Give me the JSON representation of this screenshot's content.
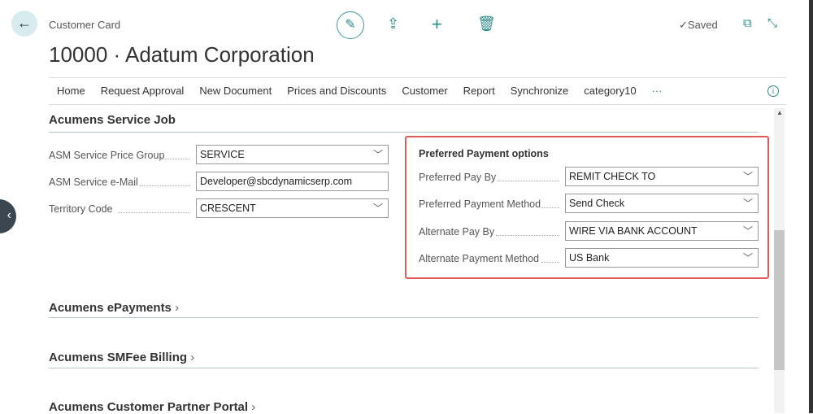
{
  "header": {
    "breadcrumb": "Customer Card",
    "title": "10000 · Adatum Corporation",
    "saved": "✓Saved"
  },
  "nav": [
    "Home",
    "Request Approval",
    "New Document",
    "Prices and Discounts",
    "Customer",
    "Report",
    "Synchronize",
    "category10",
    "···"
  ],
  "service_job": {
    "title": "Acumens Service Job",
    "fields": [
      {
        "label": "ASM Service Price Group",
        "value": "SERVICE",
        "dropdown": true
      },
      {
        "label": "ASM Service e-Mail",
        "value": "Developer@sbcdynamicserp.com",
        "dropdown": false
      },
      {
        "label": "Territory Code",
        "value": "CRESCENT",
        "dropdown": true
      }
    ]
  },
  "payment": {
    "title": "Preferred Payment options",
    "fields": [
      {
        "label": "Preferred Pay By",
        "value": "REMIT CHECK TO"
      },
      {
        "label": "Preferred Payment Method",
        "value": "Send Check"
      },
      {
        "label": "Alternate Pay By",
        "value": "WIRE VIA BANK ACCOUNT"
      },
      {
        "label": "Alternate Payment Method",
        "value": "US Bank"
      }
    ]
  },
  "sections": [
    "Acumens ePayments",
    "Acumens SMFee Billing",
    "Acumens Customer Partner Portal"
  ],
  "colors": {
    "accent": "#2a8a8a",
    "highlight": "#e05a5a"
  }
}
